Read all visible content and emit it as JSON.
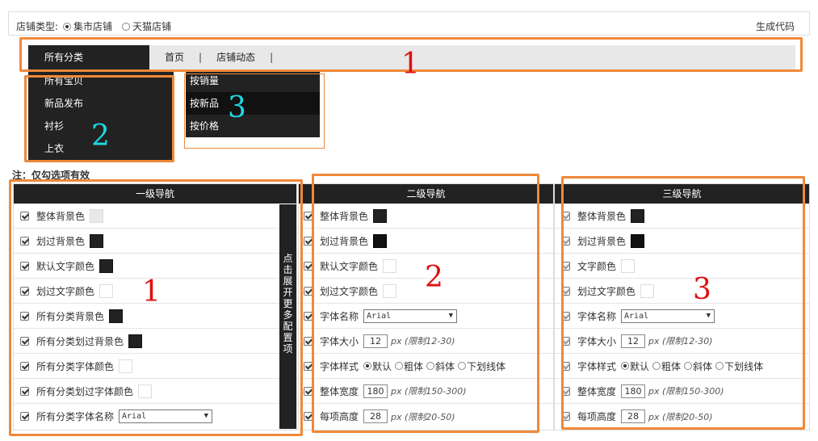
{
  "topbar": {
    "shop_type_label": "店铺类型:",
    "radio_options": [
      {
        "label": "集市店铺",
        "checked": true
      },
      {
        "label": "天猫店铺",
        "checked": false
      }
    ],
    "generate_code": "生成代码"
  },
  "nav": {
    "all_categories": "所有分类",
    "links": [
      "首页",
      "店铺动态"
    ]
  },
  "dropdown_level2": [
    "所有宝贝",
    "新品发布",
    "衬衫",
    "上衣"
  ],
  "dropdown_level3": [
    "按销量",
    "按新品",
    "按价格"
  ],
  "note": "注：仅勾选项有效",
  "panel1": {
    "title": "一级导航",
    "rows": [
      {
        "label": "整体背景色",
        "swatch": "light"
      },
      {
        "label": "划过背景色",
        "swatch": "dark"
      },
      {
        "label": "默认文字颜色",
        "swatch": "dark"
      },
      {
        "label": "划过文字颜色",
        "swatch": "white"
      },
      {
        "label": "所有分类背景色",
        "swatch": "dark"
      },
      {
        "label": "所有分类划过背景色",
        "swatch": "dark"
      },
      {
        "label": "所有分类字体颜色",
        "swatch": "white"
      },
      {
        "label": "所有分类划过字体颜色",
        "swatch": "white"
      }
    ],
    "font_label": "所有分类字体名称",
    "font_value": "Arial",
    "expand_button": "点击展开更多配置项"
  },
  "panel2": {
    "title": "二级导航",
    "rows": [
      {
        "label": "整体背景色",
        "swatch": "dark"
      },
      {
        "label": "划过背景色",
        "swatch": "black"
      },
      {
        "label": "默认文字颜色",
        "swatch": "white"
      },
      {
        "label": "划过文字颜色",
        "swatch": "white"
      }
    ],
    "font_name_label": "字体名称",
    "font_name_value": "Arial",
    "font_size_label": "字体大小",
    "font_size_value": "12",
    "font_size_hint": "px (限制12-30)",
    "font_style_label": "字体样式",
    "font_style_options": [
      {
        "label": "默认",
        "checked": true
      },
      {
        "label": "粗体",
        "checked": false
      },
      {
        "label": "斜体",
        "checked": false
      },
      {
        "label": "下划线体",
        "checked": false
      }
    ],
    "width_label": "整体宽度",
    "width_value": "180",
    "width_hint": "px (限制150-300)",
    "height_label": "每项高度",
    "height_value": "28",
    "height_hint": "px (限制20-50)"
  },
  "panel3": {
    "title": "三级导航",
    "rows": [
      {
        "label": "整体背景色",
        "swatch": "dark"
      },
      {
        "label": "划过背景色",
        "swatch": "black"
      },
      {
        "label": "文字颜色",
        "swatch": "white"
      },
      {
        "label": "划过文字颜色",
        "swatch": "white"
      }
    ],
    "font_name_label": "字体名称",
    "font_name_value": "Arial",
    "font_size_label": "字体大小",
    "font_size_value": "12",
    "font_size_hint": "px (限制12-30)",
    "font_style_label": "字体样式",
    "font_style_options": [
      {
        "label": "默认",
        "checked": true
      },
      {
        "label": "粗体",
        "checked": false
      },
      {
        "label": "斜体",
        "checked": false
      },
      {
        "label": "下划线体",
        "checked": false
      }
    ],
    "width_label": "整体宽度",
    "width_value": "180",
    "width_hint": "px (限制150-300)",
    "height_label": "每项高度",
    "height_value": "28",
    "height_hint": "px (限制20-50)"
  },
  "annotations": {
    "nav_number": "1",
    "drop2_number": "2",
    "drop3_number": "3",
    "panel1_number": "1",
    "panel2_number": "2",
    "panel3_number": "3"
  },
  "colors": {
    "annotation_border": "#f0883a",
    "annotation_red": "#e01010",
    "annotation_cyan": "#1fd8e0",
    "nav_dark": "#222222"
  }
}
